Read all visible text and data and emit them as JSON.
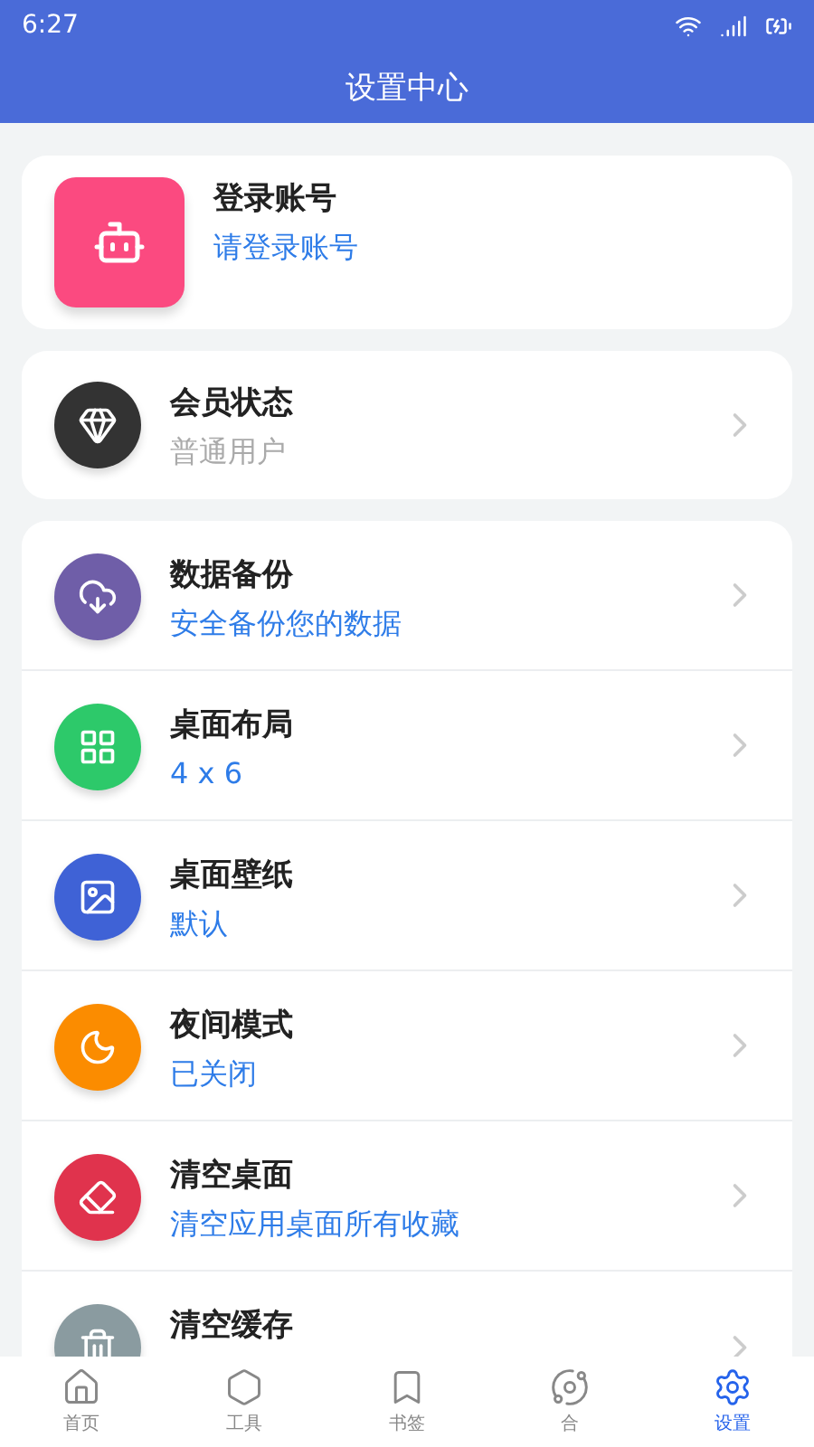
{
  "status_bar": {
    "time": "6:27"
  },
  "header": {
    "title": "设置中心"
  },
  "account": {
    "title": "登录账号",
    "subtitle": "请登录账号"
  },
  "member": {
    "title": "会员状态",
    "subtitle": "普通用户"
  },
  "settings": [
    {
      "title": "数据备份",
      "subtitle": "安全备份您的数据",
      "color": "#6f5ea8"
    },
    {
      "title": "桌面布局",
      "subtitle": "4 x 6",
      "color": "#2dc96a"
    },
    {
      "title": "桌面壁纸",
      "subtitle": "默认",
      "color": "#3f62d6"
    },
    {
      "title": "夜间模式",
      "subtitle": "已关闭",
      "color": "#fb8c00"
    },
    {
      "title": "清空桌面",
      "subtitle": "清空应用桌面所有收藏",
      "color": "#e0334d"
    },
    {
      "title": "清空缓存",
      "color": "#8a9ba0"
    }
  ],
  "nav": [
    {
      "label": "首页",
      "selected": false
    },
    {
      "label": "工具",
      "selected": false
    },
    {
      "label": "书签",
      "selected": false
    },
    {
      "label": "合",
      "selected": false
    },
    {
      "label": "设置",
      "selected": true
    }
  ]
}
